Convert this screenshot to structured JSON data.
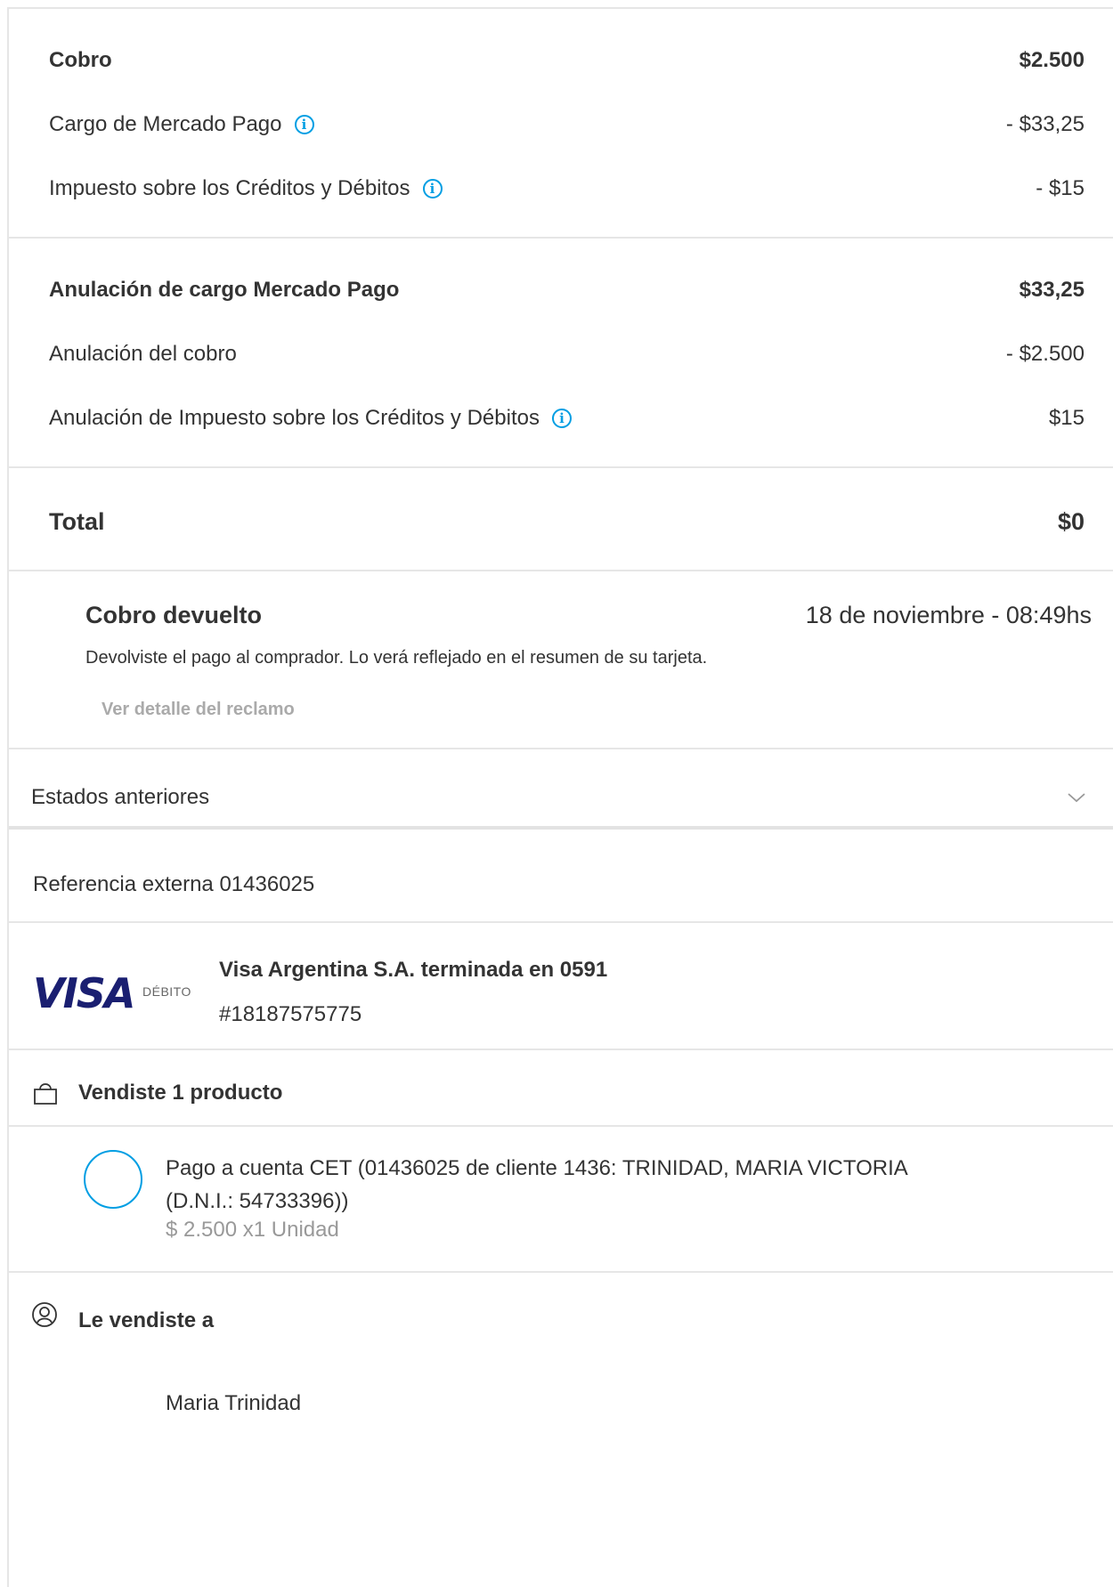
{
  "summary": {
    "rows": [
      {
        "label": "Cobro",
        "amount": "$2.500"
      },
      {
        "label": "Cargo de Mercado Pago",
        "amount": "- $33,25"
      },
      {
        "label": "Impuesto sobre los Créditos y Débitos",
        "amount": "- $15"
      },
      {
        "label": "Anulación de cargo Mercado Pago",
        "amount": "$33,25"
      },
      {
        "label": "Anulación del cobro",
        "amount": "- $2.500"
      },
      {
        "label": "Anulación de Impuesto sobre los Créditos y Débitos",
        "amount": "$15"
      }
    ],
    "total_label": "Total",
    "total_amount": "$0"
  },
  "status": {
    "title": "Cobro devuelto",
    "date": "18 de noviembre - 08:49hs",
    "description": "Devolviste el pago al comprador. Lo verá reflejado en el resumen de su tarjeta.",
    "link": "Ver detalle del reclamo"
  },
  "previous_states": {
    "label": "Estados anteriores",
    "icon": "chevron-down-icon"
  },
  "external_reference": "Referencia externa 01436025",
  "payment_method": {
    "brand": "VISA",
    "type": "DÉBITO",
    "title": "Visa Argentina S.A. terminada en 0591",
    "operation": "#18187575775"
  },
  "products": {
    "title": "Vendiste 1 producto",
    "items": [
      {
        "name": "Pago a cuenta CET (01436025 de cliente 1436: TRINIDAD, MARIA VICTORIA (D.N.I.: 54733396))",
        "price": "$ 2.500 x1 Unidad"
      }
    ]
  },
  "buyer": {
    "title": "Le vendiste a",
    "name": "Maria Trinidad"
  },
  "colors": {
    "accent": "#009ee3",
    "visa_blue": "#1a1f71",
    "divider": "#e6e6e6",
    "muted": "#999999"
  }
}
